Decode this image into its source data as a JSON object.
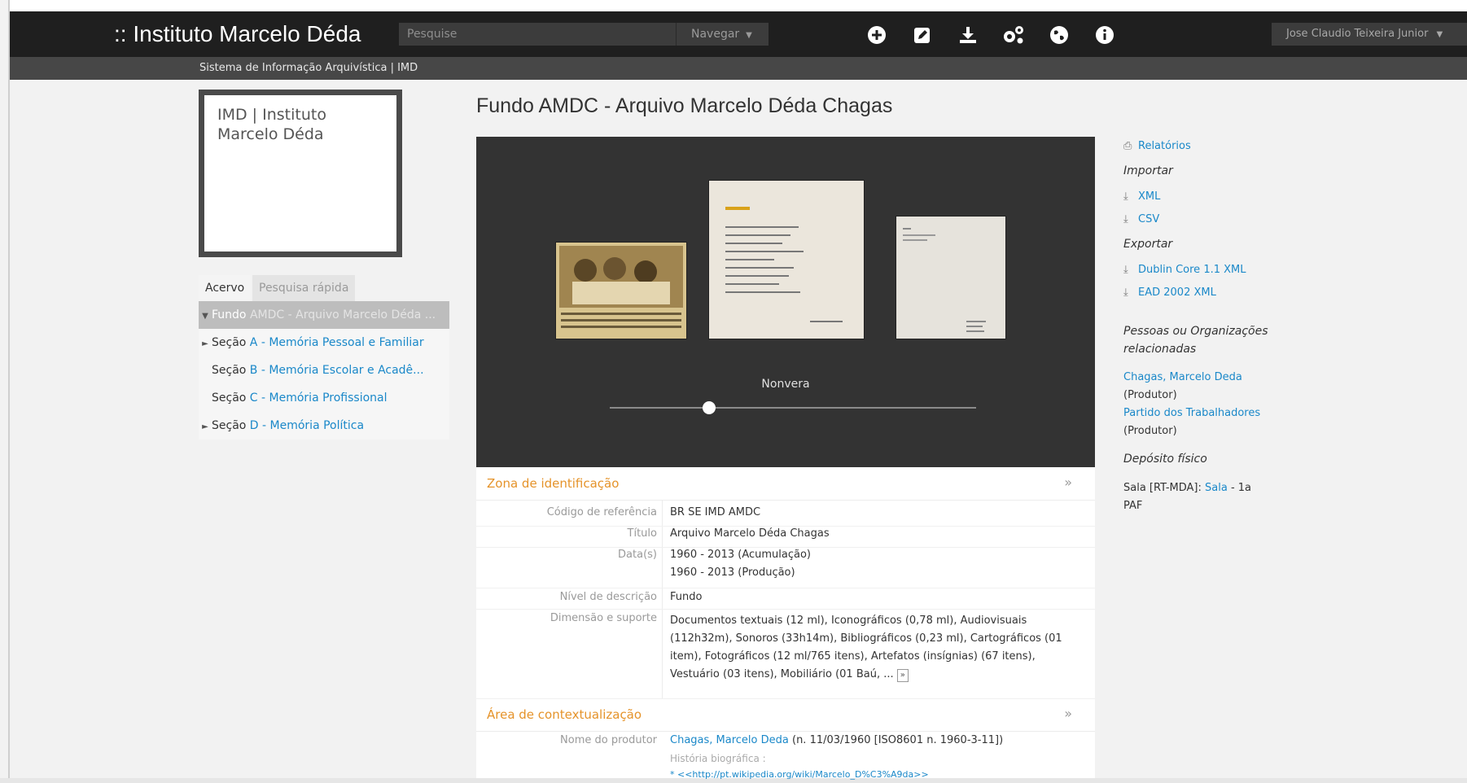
{
  "header": {
    "site_title": ":: Instituto Marcelo Déda",
    "search_placeholder": "Pesquise",
    "browse_label": "Navegar",
    "user_name": "Jose Claudio Teixeira Junior"
  },
  "subheader": {
    "text": "Sistema de Informação Arquivística | IMD"
  },
  "repository": {
    "logo_text": "IMD | Instituto Marcelo Déda"
  },
  "tree": {
    "tabs": [
      "Acervo",
      "Pesquisa rápida"
    ],
    "items": [
      {
        "level": "Fundo",
        "title": "AMDC - Arquivo Marcelo Déda ...",
        "arrow": "▼"
      },
      {
        "level": "Seção",
        "title": "A - Memória Pessoal e Familiar",
        "arrow": "►"
      },
      {
        "level": "Seção",
        "title": "B - Memória Escolar e Acadê...",
        "arrow": ""
      },
      {
        "level": "Seção",
        "title": "C - Memória Profissional",
        "arrow": ""
      },
      {
        "level": "Seção",
        "title": "D - Memória Política",
        "arrow": "►"
      }
    ]
  },
  "main": {
    "title": "Fundo AMDC - Arquivo Marcelo Déda Chagas",
    "carousel": {
      "caption": "Nonvera",
      "slider_position": 0.27
    },
    "sections": [
      {
        "title": "Zona de identificação",
        "toggle": "»",
        "fields": [
          {
            "label": "Código de referência",
            "value": "BR SE IMD AMDC"
          },
          {
            "label": "Título",
            "value": "Arquivo Marcelo Déda Chagas"
          },
          {
            "label": "Data(s)",
            "value": "1960 - 2013 (Acumulação)",
            "value2": "1960 - 2013 (Produção)"
          },
          {
            "label": "Nível de descrição",
            "value": "Fundo"
          },
          {
            "label": "Dimensão e suporte",
            "value": "Documentos textuais (12 ml), Iconográficos (0,78 ml), Audiovisuais (112h32m), Sonoros (33h14m), Bibliográficos (0,23 ml), Cartográficos (01 item), Fotográficos (12 ml/765 itens), Artefatos (insígnias) (67 itens), Vestuário (03 itens), Mobiliário (01 Baú, ...",
            "more": "»"
          }
        ]
      },
      {
        "title": "Área de contextualização",
        "toggle": "»",
        "fields": [
          {
            "label": "Nome do produtor",
            "value_link": "Chagas, Marcelo Deda",
            "value": " (n. 11/03/1960 [ISO8601 n. 1960-3-11])",
            "sub": "História biográfica :",
            "sub2": "* <<http://pt.wikipedia.org/wiki/Marcelo_D%C3%A9da>>"
          }
        ]
      }
    ]
  },
  "sidebar_right": {
    "reports": "Relatórios",
    "import_head": "Importar",
    "import_xml": "XML",
    "import_csv": "CSV",
    "export_head": "Exportar",
    "export_dc": "Dublin Core 1.1 XML",
    "export_ead": "EAD 2002 XML",
    "related_head": "Pessoas ou Organizações relacionadas",
    "related": [
      {
        "name": "Chagas, Marcelo Deda",
        "role": "(Produtor)"
      },
      {
        "name": "Partido dos Trabalhadores",
        "role": "(Produtor)"
      }
    ],
    "physical_head": "Depósito físico",
    "physical_prefix": "Sala [RT-MDA]: ",
    "physical_link": "Sala",
    "physical_suffix": " - 1a",
    "physical_line2": "PAF"
  }
}
